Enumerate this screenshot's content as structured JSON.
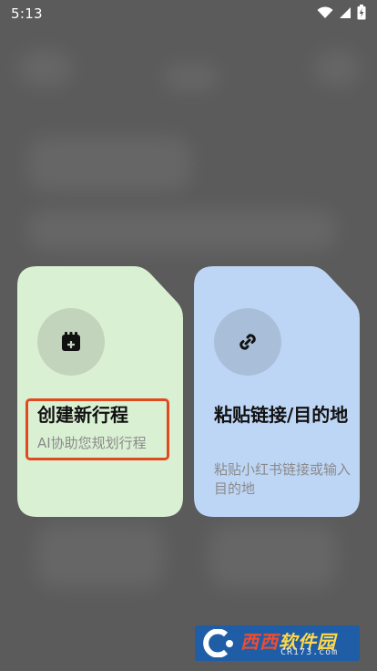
{
  "status_bar": {
    "time": "5:13"
  },
  "cards": [
    {
      "title": "创建新行程",
      "subtitle": "AI协助您规划行程",
      "icon": "calendar-add-icon",
      "color": "#d9f0d3"
    },
    {
      "title": "粘贴链接/目的地",
      "subtitle": "粘贴小红书链接或输入目的地",
      "icon": "link-icon",
      "color": "#bed6f5"
    }
  ],
  "watermark": {
    "brand_a": "西西",
    "brand_b": "软件园",
    "domain": "CR173.com"
  },
  "colors": {
    "highlight": "#e04a1f",
    "backdrop": "#5b5b5b"
  }
}
